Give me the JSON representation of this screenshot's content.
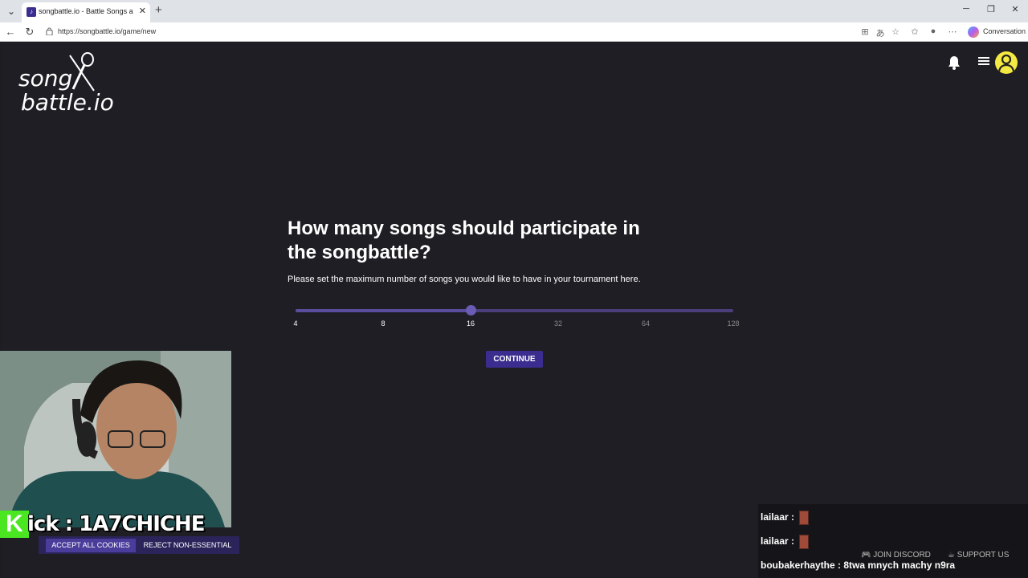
{
  "browser": {
    "tab_title": "songbattle.io - Battle Songs again",
    "url": "https://songbattle.io/game/new",
    "conversation_label": "Conversation"
  },
  "page": {
    "logo_line1": "song",
    "logo_line2": "battle.io",
    "question": "How many songs should participate in the songbattle?",
    "description": "Please set the maximum number of songs you would like to have in your tournament here.",
    "slider": {
      "min": 4,
      "max": 128,
      "value": 16,
      "ticks": [
        "4",
        "8",
        "16",
        "32",
        "64",
        "128"
      ]
    },
    "continue_label": "CONTINUE"
  },
  "cookies": {
    "accept_label": "ACCEPT ALL COOKIES",
    "reject_label": "REJECT NON-ESSENTIAL"
  },
  "overlay": {
    "kick_text": "ick : 1A7CHICHE",
    "kick_letter": "K",
    "join_discord": "JOIN DISCORD",
    "support_us": "SUPPORT US",
    "chat": [
      {
        "user": "lailaar",
        "message": ""
      },
      {
        "user": "lailaar",
        "message": ""
      },
      {
        "user": "boubakerhaythe",
        "message": "8twa mnych machy n9ra"
      }
    ]
  },
  "colors": {
    "background": "#1f1e24",
    "accent": "#3b2d8f",
    "avatar": "#f4e842"
  }
}
